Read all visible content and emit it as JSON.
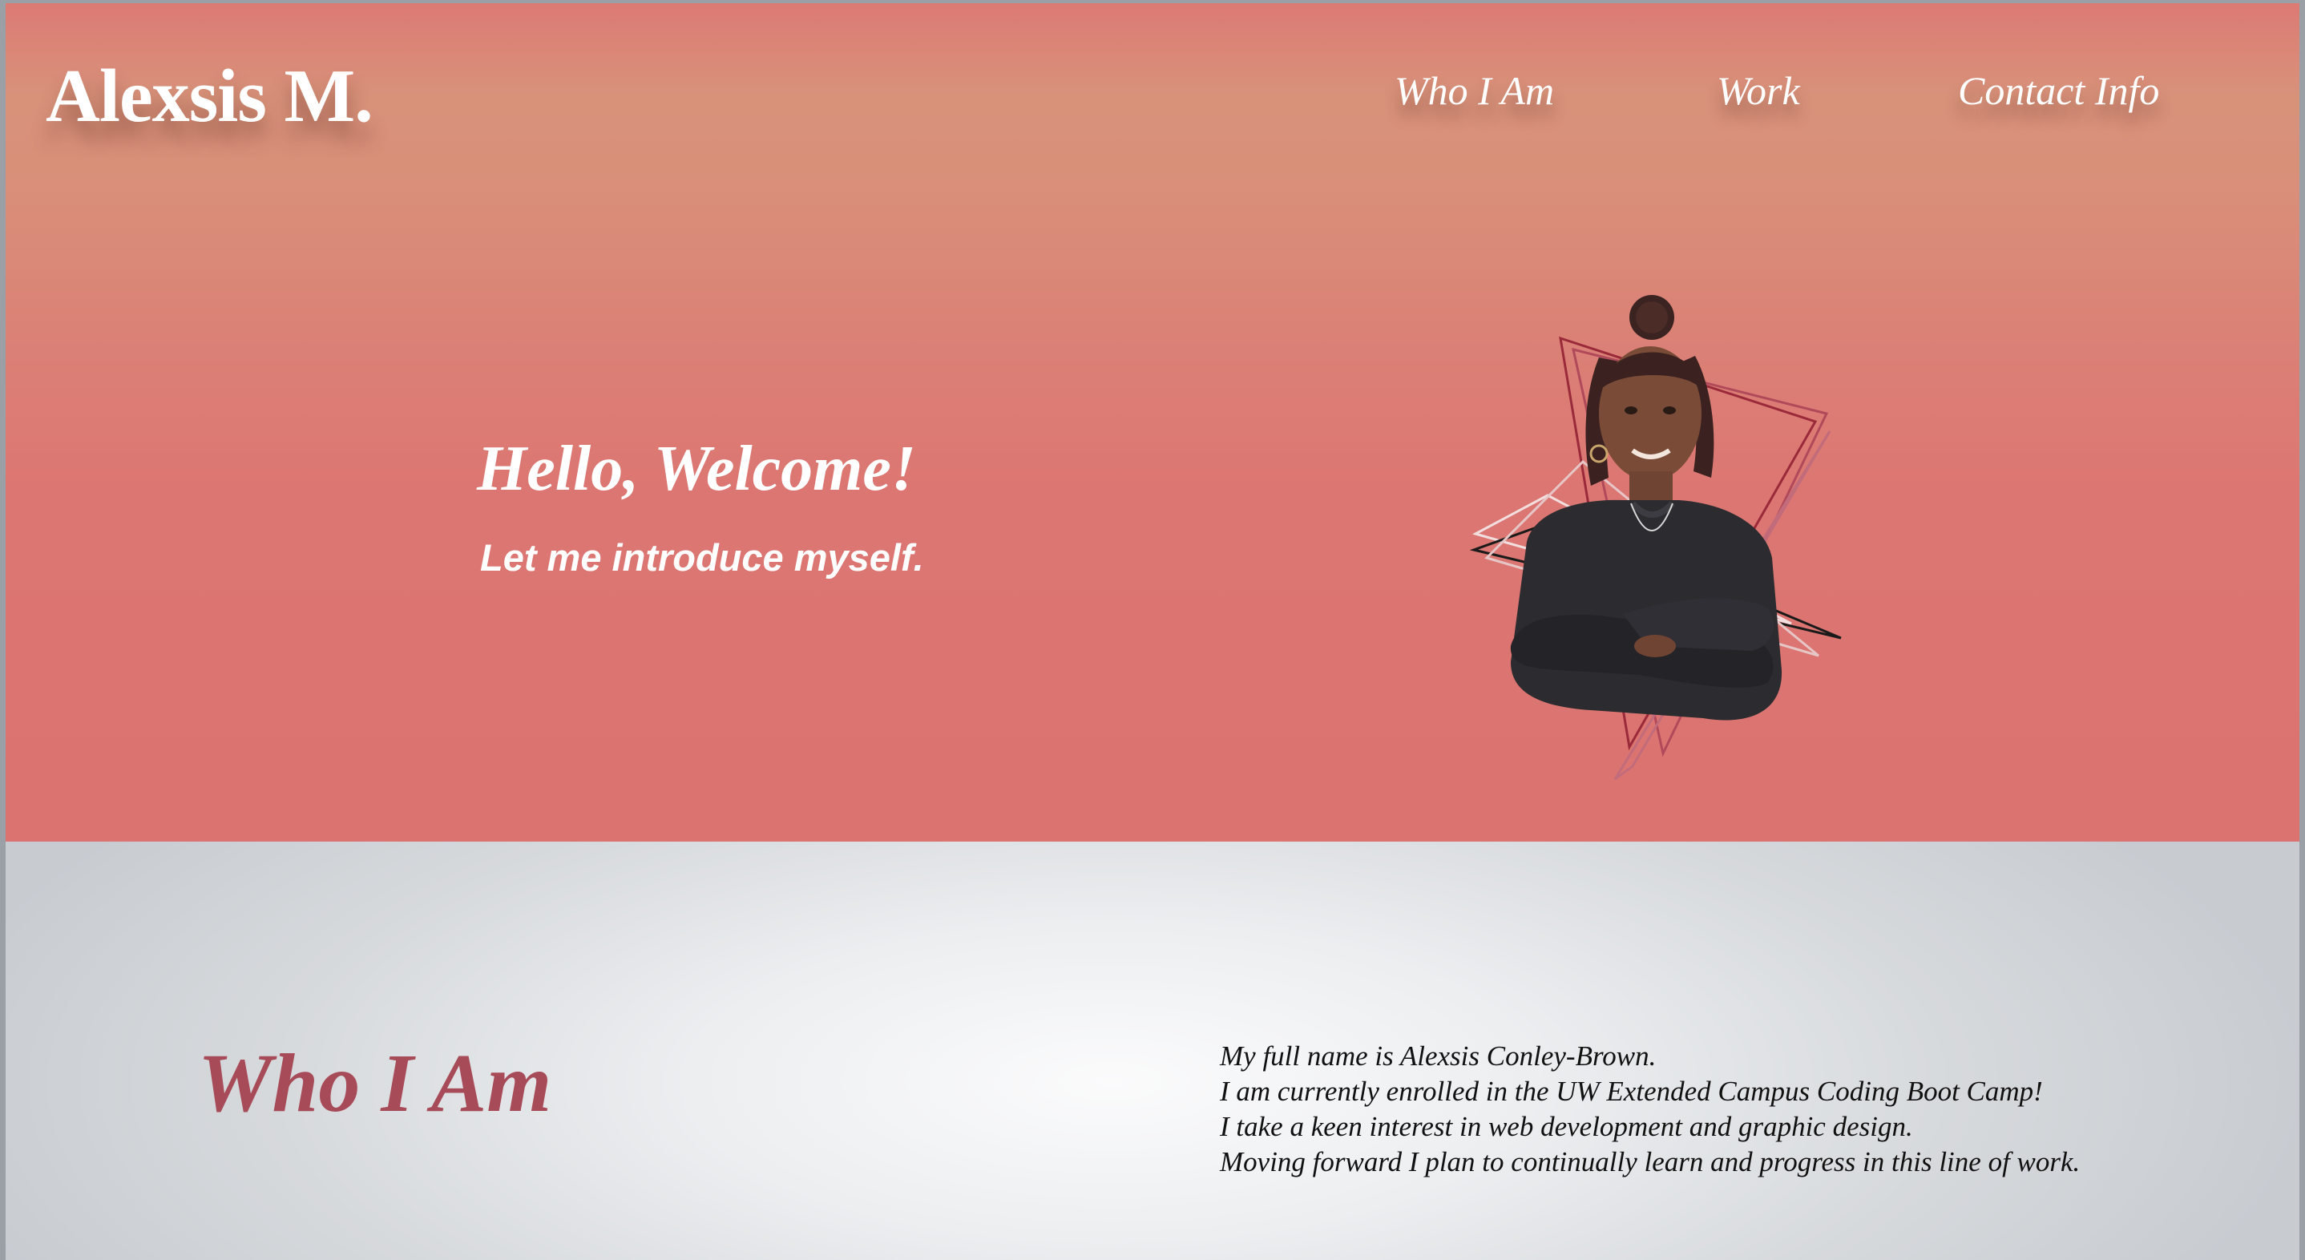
{
  "header": {
    "brand": "Alexsis M.",
    "nav": [
      {
        "label": "Who I Am"
      },
      {
        "label": "Work"
      },
      {
        "label": "Contact Info"
      }
    ]
  },
  "hero": {
    "title": "Hello, Welcome!",
    "subtitle": "Let me introduce myself.",
    "portrait_icon": "portrait-photo"
  },
  "about": {
    "heading": "Who I Am",
    "lines": [
      "My full name is Alexsis Conley-Brown.",
      "I am currently enrolled in the UW Extended Campus Coding Boot Camp!",
      "I take a keen interest in web development and graphic design.",
      "Moving forward I plan to continually learn and progress in this line of work."
    ]
  },
  "colors": {
    "hero_top": "#dc7a74",
    "hero_peach": "#d8927a",
    "hero_bottom": "#db7470",
    "accent_heading": "#a84b58",
    "text_dark": "#111111",
    "white": "#ffffff"
  }
}
